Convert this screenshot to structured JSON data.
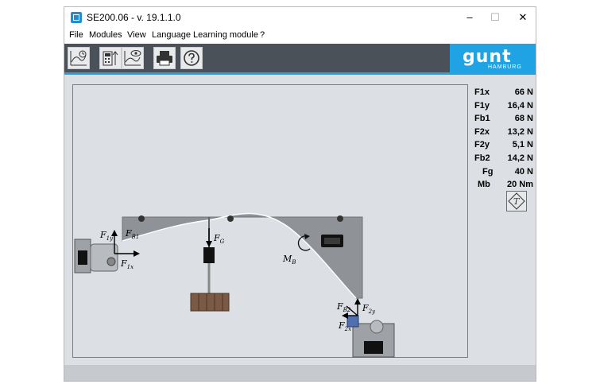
{
  "window": {
    "title": "SE200.06 - v. 19.1.1.0",
    "minimize_symbol": "–",
    "maximize_symbol": "☐",
    "close_symbol": "✕"
  },
  "menu": [
    "File",
    "Modules",
    "View",
    "Language",
    "Learning module",
    "?"
  ],
  "toolbar": {
    "buttons": [
      "chart-clock-icon",
      "measurement-data-icon",
      "chart-eye-icon",
      "printer-icon",
      "help-icon"
    ]
  },
  "logo": {
    "text": "gunt",
    "subtext": "HAMBURG",
    "color": "#1fa3e4"
  },
  "readouts": [
    {
      "label": "F1x",
      "value": "66 N"
    },
    {
      "label": "F1y",
      "value": "16,4 N"
    },
    {
      "label": "Fb1",
      "value": "68 N"
    },
    {
      "label": "F2x",
      "value": "13,2 N"
    },
    {
      "label": "F2y",
      "value": "5,1 N"
    },
    {
      "label": "Fb2",
      "value": "14,2 N"
    },
    {
      "label": "Fg",
      "value": "40 N"
    },
    {
      "label": "Mb",
      "value": "20 Nm"
    }
  ],
  "diagram": {
    "labels": {
      "f1y": {
        "main": "F",
        "sub": "1y"
      },
      "fb1": {
        "main": "F",
        "sub": "B1"
      },
      "f1x": {
        "main": "F",
        "sub": "1x"
      },
      "fg": {
        "main": "F",
        "sub": "G"
      },
      "mb": {
        "main": "M",
        "sub": "B"
      },
      "fb2": {
        "main": "F",
        "sub": "B2"
      },
      "f2y": {
        "main": "F",
        "sub": "2y"
      },
      "f2x": {
        "main": "F",
        "sub": "2x"
      }
    }
  },
  "colors": {
    "toolbar": "#4a5159",
    "accent": "#1fa3e4",
    "background": "#dcdfe3",
    "plate": "#8f9296"
  }
}
